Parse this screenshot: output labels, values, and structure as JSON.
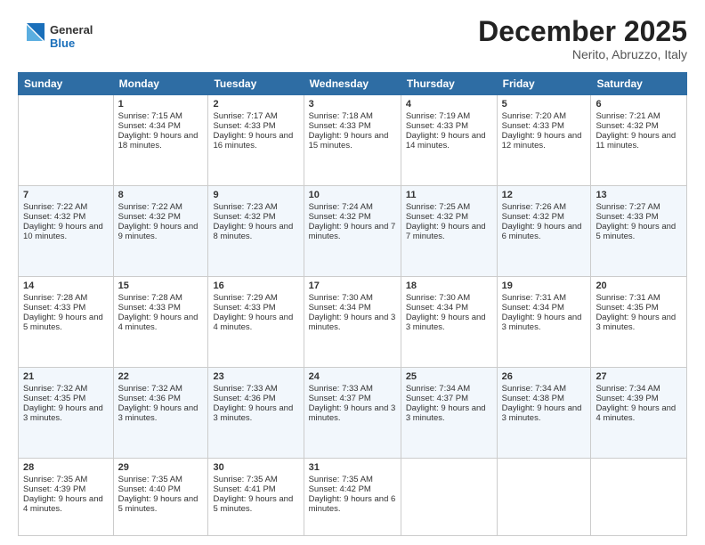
{
  "header": {
    "logo_general": "General",
    "logo_blue": "Blue",
    "month_title": "December 2025",
    "location": "Nerito, Abruzzo, Italy"
  },
  "days_of_week": [
    "Sunday",
    "Monday",
    "Tuesday",
    "Wednesday",
    "Thursday",
    "Friday",
    "Saturday"
  ],
  "weeks": [
    [
      {
        "num": "",
        "sunrise": "",
        "sunset": "",
        "daylight": ""
      },
      {
        "num": "1",
        "sunrise": "Sunrise: 7:15 AM",
        "sunset": "Sunset: 4:34 PM",
        "daylight": "Daylight: 9 hours and 18 minutes."
      },
      {
        "num": "2",
        "sunrise": "Sunrise: 7:17 AM",
        "sunset": "Sunset: 4:33 PM",
        "daylight": "Daylight: 9 hours and 16 minutes."
      },
      {
        "num": "3",
        "sunrise": "Sunrise: 7:18 AM",
        "sunset": "Sunset: 4:33 PM",
        "daylight": "Daylight: 9 hours and 15 minutes."
      },
      {
        "num": "4",
        "sunrise": "Sunrise: 7:19 AM",
        "sunset": "Sunset: 4:33 PM",
        "daylight": "Daylight: 9 hours and 14 minutes."
      },
      {
        "num": "5",
        "sunrise": "Sunrise: 7:20 AM",
        "sunset": "Sunset: 4:33 PM",
        "daylight": "Daylight: 9 hours and 12 minutes."
      },
      {
        "num": "6",
        "sunrise": "Sunrise: 7:21 AM",
        "sunset": "Sunset: 4:32 PM",
        "daylight": "Daylight: 9 hours and 11 minutes."
      }
    ],
    [
      {
        "num": "7",
        "sunrise": "Sunrise: 7:22 AM",
        "sunset": "Sunset: 4:32 PM",
        "daylight": "Daylight: 9 hours and 10 minutes."
      },
      {
        "num": "8",
        "sunrise": "Sunrise: 7:22 AM",
        "sunset": "Sunset: 4:32 PM",
        "daylight": "Daylight: 9 hours and 9 minutes."
      },
      {
        "num": "9",
        "sunrise": "Sunrise: 7:23 AM",
        "sunset": "Sunset: 4:32 PM",
        "daylight": "Daylight: 9 hours and 8 minutes."
      },
      {
        "num": "10",
        "sunrise": "Sunrise: 7:24 AM",
        "sunset": "Sunset: 4:32 PM",
        "daylight": "Daylight: 9 hours and 7 minutes."
      },
      {
        "num": "11",
        "sunrise": "Sunrise: 7:25 AM",
        "sunset": "Sunset: 4:32 PM",
        "daylight": "Daylight: 9 hours and 7 minutes."
      },
      {
        "num": "12",
        "sunrise": "Sunrise: 7:26 AM",
        "sunset": "Sunset: 4:32 PM",
        "daylight": "Daylight: 9 hours and 6 minutes."
      },
      {
        "num": "13",
        "sunrise": "Sunrise: 7:27 AM",
        "sunset": "Sunset: 4:33 PM",
        "daylight": "Daylight: 9 hours and 5 minutes."
      }
    ],
    [
      {
        "num": "14",
        "sunrise": "Sunrise: 7:28 AM",
        "sunset": "Sunset: 4:33 PM",
        "daylight": "Daylight: 9 hours and 5 minutes."
      },
      {
        "num": "15",
        "sunrise": "Sunrise: 7:28 AM",
        "sunset": "Sunset: 4:33 PM",
        "daylight": "Daylight: 9 hours and 4 minutes."
      },
      {
        "num": "16",
        "sunrise": "Sunrise: 7:29 AM",
        "sunset": "Sunset: 4:33 PM",
        "daylight": "Daylight: 9 hours and 4 minutes."
      },
      {
        "num": "17",
        "sunrise": "Sunrise: 7:30 AM",
        "sunset": "Sunset: 4:34 PM",
        "daylight": "Daylight: 9 hours and 3 minutes."
      },
      {
        "num": "18",
        "sunrise": "Sunrise: 7:30 AM",
        "sunset": "Sunset: 4:34 PM",
        "daylight": "Daylight: 9 hours and 3 minutes."
      },
      {
        "num": "19",
        "sunrise": "Sunrise: 7:31 AM",
        "sunset": "Sunset: 4:34 PM",
        "daylight": "Daylight: 9 hours and 3 minutes."
      },
      {
        "num": "20",
        "sunrise": "Sunrise: 7:31 AM",
        "sunset": "Sunset: 4:35 PM",
        "daylight": "Daylight: 9 hours and 3 minutes."
      }
    ],
    [
      {
        "num": "21",
        "sunrise": "Sunrise: 7:32 AM",
        "sunset": "Sunset: 4:35 PM",
        "daylight": "Daylight: 9 hours and 3 minutes."
      },
      {
        "num": "22",
        "sunrise": "Sunrise: 7:32 AM",
        "sunset": "Sunset: 4:36 PM",
        "daylight": "Daylight: 9 hours and 3 minutes."
      },
      {
        "num": "23",
        "sunrise": "Sunrise: 7:33 AM",
        "sunset": "Sunset: 4:36 PM",
        "daylight": "Daylight: 9 hours and 3 minutes."
      },
      {
        "num": "24",
        "sunrise": "Sunrise: 7:33 AM",
        "sunset": "Sunset: 4:37 PM",
        "daylight": "Daylight: 9 hours and 3 minutes."
      },
      {
        "num": "25",
        "sunrise": "Sunrise: 7:34 AM",
        "sunset": "Sunset: 4:37 PM",
        "daylight": "Daylight: 9 hours and 3 minutes."
      },
      {
        "num": "26",
        "sunrise": "Sunrise: 7:34 AM",
        "sunset": "Sunset: 4:38 PM",
        "daylight": "Daylight: 9 hours and 3 minutes."
      },
      {
        "num": "27",
        "sunrise": "Sunrise: 7:34 AM",
        "sunset": "Sunset: 4:39 PM",
        "daylight": "Daylight: 9 hours and 4 minutes."
      }
    ],
    [
      {
        "num": "28",
        "sunrise": "Sunrise: 7:35 AM",
        "sunset": "Sunset: 4:39 PM",
        "daylight": "Daylight: 9 hours and 4 minutes."
      },
      {
        "num": "29",
        "sunrise": "Sunrise: 7:35 AM",
        "sunset": "Sunset: 4:40 PM",
        "daylight": "Daylight: 9 hours and 5 minutes."
      },
      {
        "num": "30",
        "sunrise": "Sunrise: 7:35 AM",
        "sunset": "Sunset: 4:41 PM",
        "daylight": "Daylight: 9 hours and 5 minutes."
      },
      {
        "num": "31",
        "sunrise": "Sunrise: 7:35 AM",
        "sunset": "Sunset: 4:42 PM",
        "daylight": "Daylight: 9 hours and 6 minutes."
      },
      {
        "num": "",
        "sunrise": "",
        "sunset": "",
        "daylight": ""
      },
      {
        "num": "",
        "sunrise": "",
        "sunset": "",
        "daylight": ""
      },
      {
        "num": "",
        "sunrise": "",
        "sunset": "",
        "daylight": ""
      }
    ]
  ]
}
